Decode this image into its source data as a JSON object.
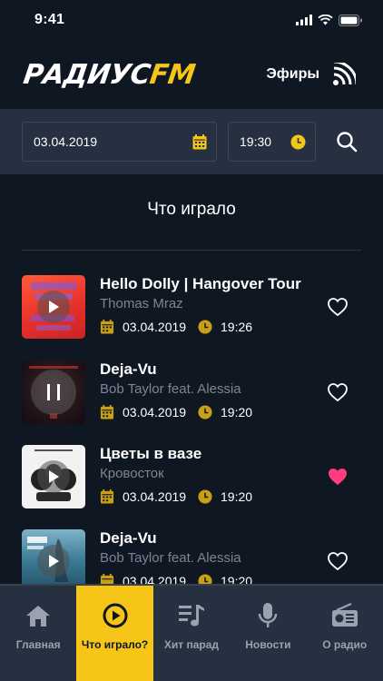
{
  "status": {
    "time": "9:41"
  },
  "header": {
    "logo_main": "РАДИУС",
    "logo_accent": "FM",
    "air_label": "Эфиры"
  },
  "filters": {
    "date_value": "03.04.2019",
    "time_value": "19:30"
  },
  "page_title": "Что играло",
  "tracks": [
    {
      "title": "Hello Dolly | Hangover Tour",
      "artist": "Thomas Mraz",
      "date": "03.04.2019",
      "time": "19:26",
      "favorite": false,
      "state": "play"
    },
    {
      "title": "Deja-Vu",
      "artist": "Bob Taylor feat. Alessia",
      "date": "03.04.2019",
      "time": "19:20",
      "favorite": false,
      "state": "pause"
    },
    {
      "title": "Цветы в вазе",
      "artist": "Кровосток",
      "date": "03.04.2019",
      "time": "19:20",
      "favorite": true,
      "state": "play"
    },
    {
      "title": "Deja-Vu",
      "artist": "Bob Taylor feat. Alessia",
      "date": "03.04.2019",
      "time": "19:20",
      "favorite": false,
      "state": "play"
    }
  ],
  "tabs": [
    {
      "label": "Главная",
      "icon": "home-icon",
      "active": false
    },
    {
      "label": "Что играло?",
      "icon": "play-circle-icon",
      "active": true
    },
    {
      "label": "Хит парад",
      "icon": "playlist-icon",
      "active": false
    },
    {
      "label": "Новости",
      "icon": "microphone-icon",
      "active": false
    },
    {
      "label": "О радио",
      "icon": "radio-icon",
      "active": false
    }
  ],
  "colors": {
    "background": "#0f1723",
    "panel": "#263040",
    "accent": "#f5c518",
    "favorite": "#ff3d7f",
    "muted_text": "#7c8593"
  }
}
